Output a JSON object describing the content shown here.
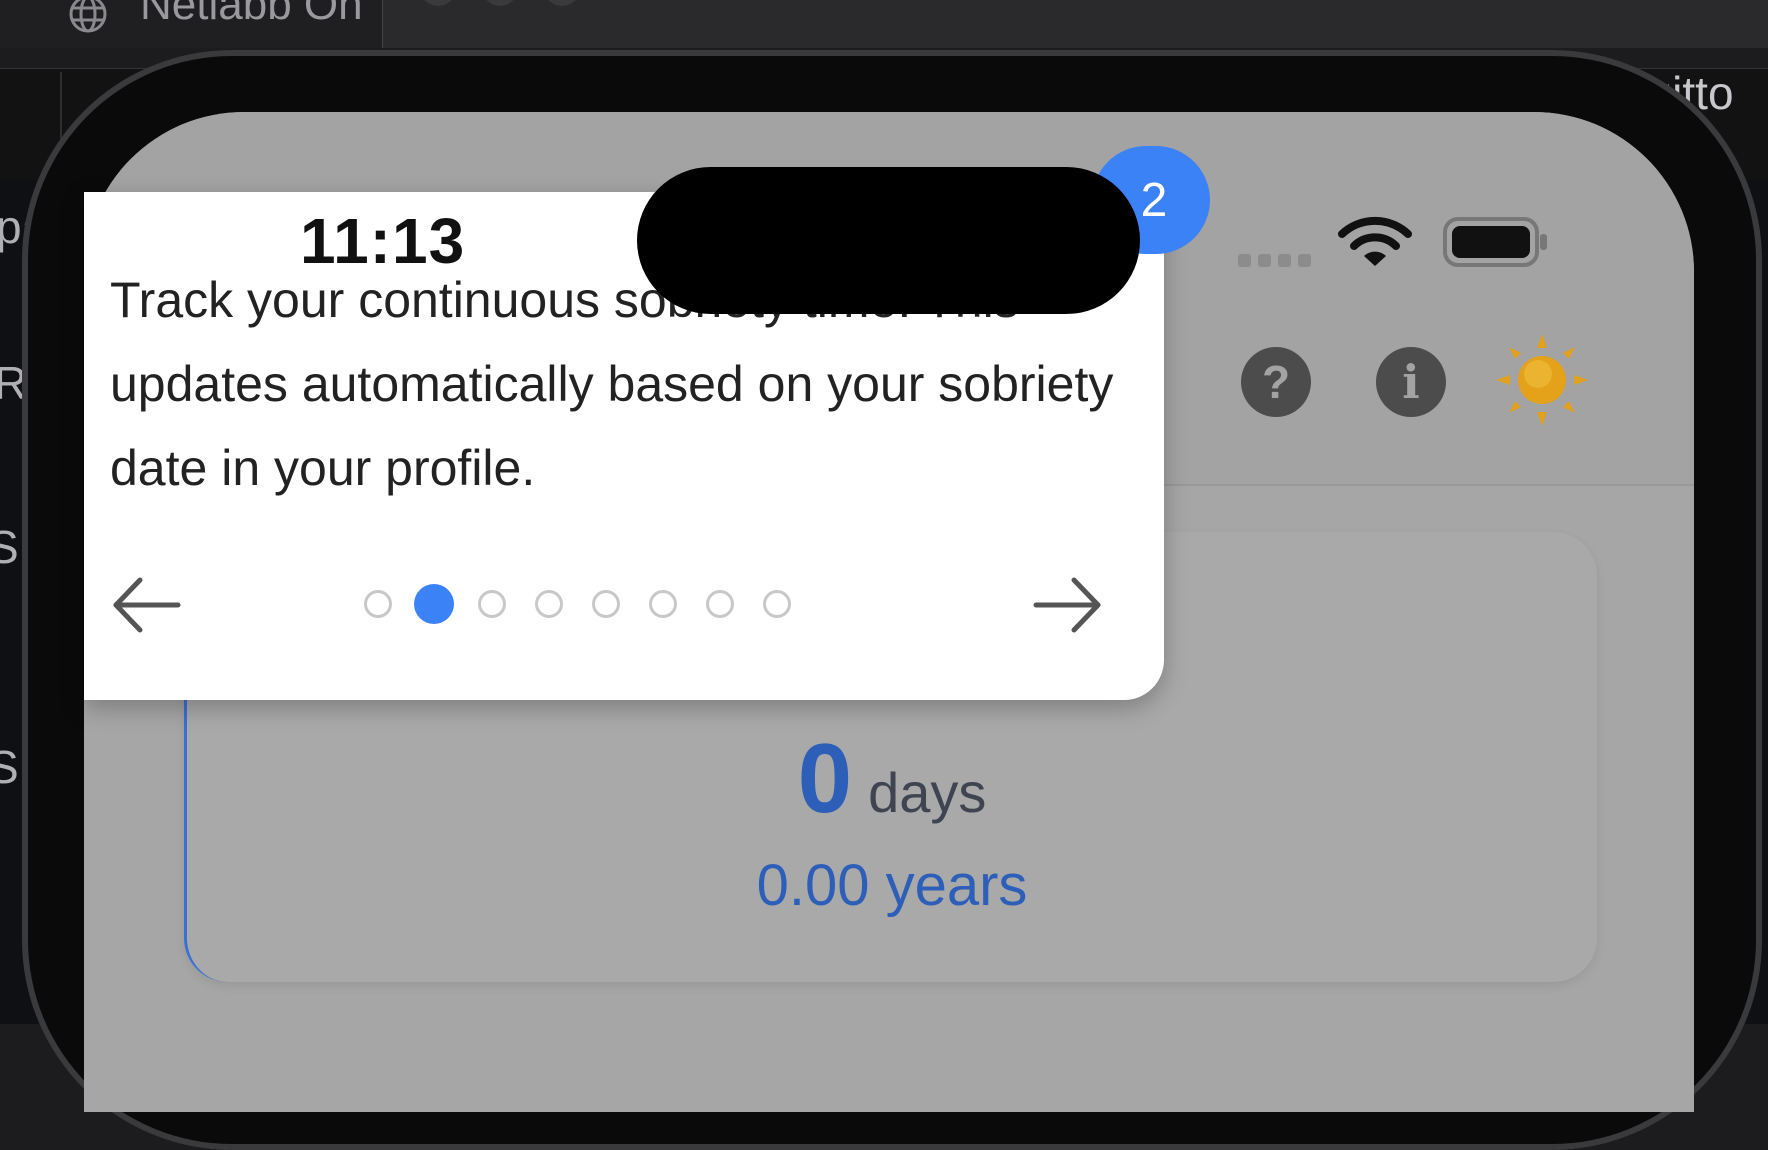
{
  "desktop": {
    "tab_title": "Netlabb On",
    "right_label": "squitto",
    "left_chars": [
      "pa",
      "R",
      "S",
      "S"
    ]
  },
  "status_bar": {
    "time": "11:13"
  },
  "header": {
    "help_glyph": "?",
    "info_glyph": "i"
  },
  "tooltip": {
    "text": "Track your continuous sobriety time. This updates automatically based on your sobriety date in your profile.",
    "step_badge": "2",
    "total_steps": 8,
    "current_step": 2
  },
  "counter": {
    "days_value": "0",
    "days_unit": "days",
    "years": "0.00 years"
  },
  "colors": {
    "accent": "#3b82f6",
    "counter_blue": "#2e5fb8",
    "overlay_gray": "#a6a6a6"
  },
  "icons": [
    "globe-icon",
    "help-icon",
    "info-icon",
    "sun-icon",
    "wifi-icon",
    "battery-icon",
    "arrow-left-icon",
    "arrow-right-icon"
  ]
}
